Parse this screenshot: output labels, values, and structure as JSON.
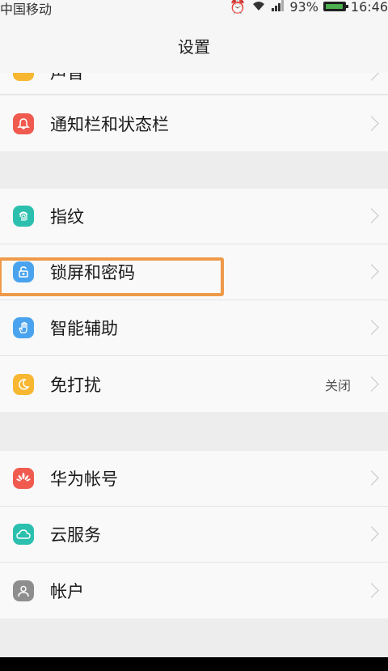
{
  "status_bar": {
    "carrier": "中国移动",
    "battery_percent": "93%",
    "time": "16:46"
  },
  "title": "设置",
  "partial_row": {
    "label": "声音",
    "icon": "bell-icon-cut",
    "color": "#f7b731"
  },
  "groups": [
    {
      "items": [
        {
          "label": "通知栏和状态栏",
          "icon": "notification-bell-icon",
          "color": "#f05a4f",
          "value": ""
        }
      ]
    },
    {
      "items": [
        {
          "label": "指纹",
          "icon": "fingerprint-icon",
          "color": "#2bbfae",
          "value": ""
        },
        {
          "label": "锁屏和密码",
          "icon": "lock-icon",
          "color": "#4aa3ee",
          "value": ""
        },
        {
          "label": "智能辅助",
          "icon": "hand-icon",
          "color": "#4aa3ee",
          "value": ""
        },
        {
          "label": "免打扰",
          "icon": "moon-icon",
          "color": "#f7b731",
          "value": "关闭"
        }
      ]
    },
    {
      "items": [
        {
          "label": "华为帐号",
          "icon": "huawei-logo-icon",
          "color": "#f05a4f",
          "value": ""
        },
        {
          "label": "云服务",
          "icon": "cloud-icon",
          "color": "#2bbfae",
          "value": ""
        },
        {
          "label": "帐户",
          "icon": "user-icon",
          "color": "#8e8e8e",
          "value": ""
        }
      ]
    }
  ]
}
